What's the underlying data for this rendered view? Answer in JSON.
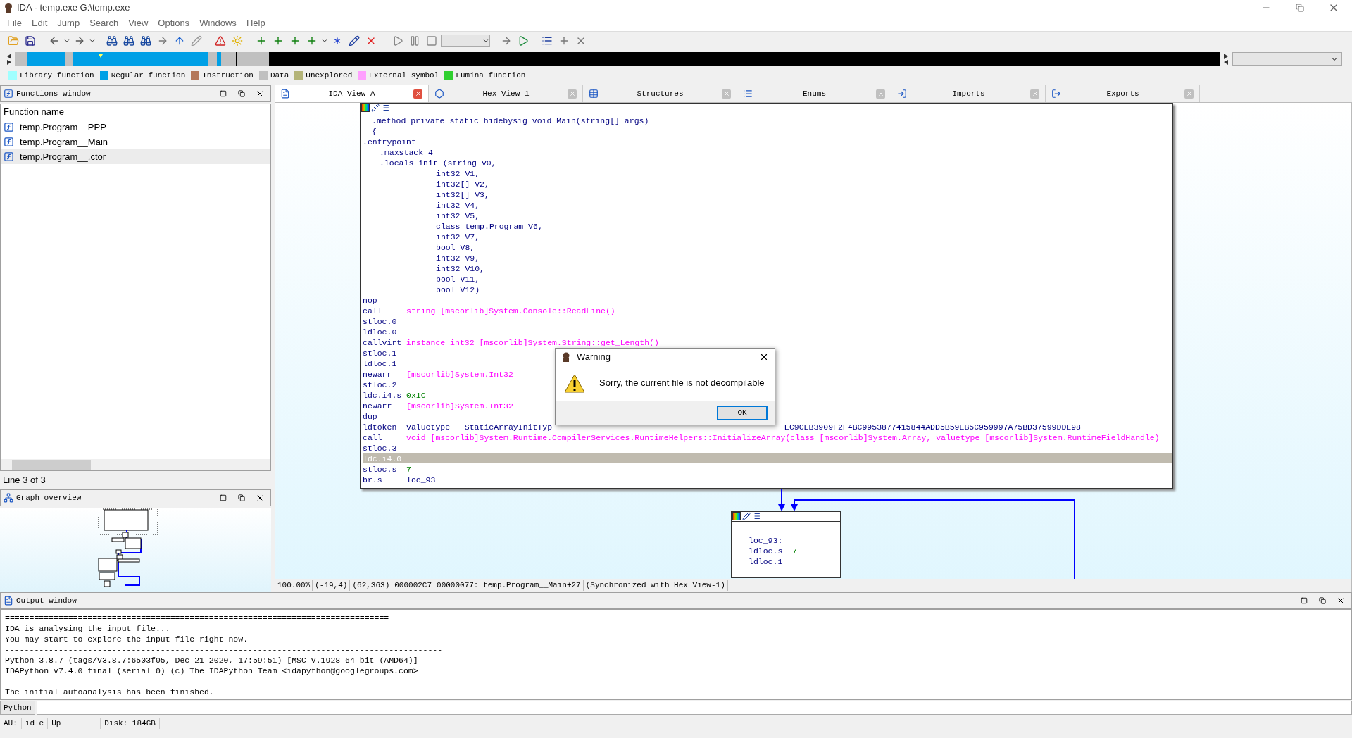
{
  "window": {
    "title": "IDA - temp.exe G:\\temp.exe"
  },
  "menu": [
    "File",
    "Edit",
    "Jump",
    "Search",
    "View",
    "Options",
    "Windows",
    "Help"
  ],
  "legend": [
    {
      "label": "Library function",
      "color": "#a0ffff"
    },
    {
      "label": "Regular function",
      "color": "#00a0e6"
    },
    {
      "label": "Instruction",
      "color": "#b4785a"
    },
    {
      "label": "Data",
      "color": "#c0c0c0"
    },
    {
      "label": "Unexplored",
      "color": "#b4b478"
    },
    {
      "label": "External symbol",
      "color": "#ffa0ff"
    },
    {
      "label": "Lumina function",
      "color": "#30d030"
    }
  ],
  "functions_window": {
    "title": "Functions window",
    "column": "Function name",
    "items": [
      {
        "name": "temp.Program__PPP",
        "selected": false
      },
      {
        "name": "temp.Program__Main",
        "selected": false
      },
      {
        "name": "temp.Program__.ctor",
        "selected": true
      }
    ],
    "status": "Line 3 of 3"
  },
  "graph_overview": {
    "title": "Graph overview"
  },
  "tabs": [
    {
      "label": "IDA View-A",
      "selected": true
    },
    {
      "label": "Hex View-1",
      "selected": false
    },
    {
      "label": "Structures",
      "selected": false
    },
    {
      "label": "Enums",
      "selected": false
    },
    {
      "label": "Imports",
      "selected": false
    },
    {
      "label": "Exports",
      "selected": false
    }
  ],
  "code": [
    {
      "kind": "decl",
      "text": ".method private static hidebysig void Main(string[] args)",
      "selected": false
    },
    {
      "kind": "decl",
      "text": "{",
      "selected": false
    },
    {
      "kind": "directive",
      "text": ".entrypoint",
      "selected": false
    },
    {
      "kind": "param",
      "text": ".maxstack 4",
      "selected": false
    },
    {
      "kind": "param",
      "text": ".locals init (string V0,",
      "selected": false
    },
    {
      "kind": "local",
      "text": "int32 V1,",
      "selected": false
    },
    {
      "kind": "local",
      "text": "int32[] V2,",
      "selected": false
    },
    {
      "kind": "local",
      "text": "int32[] V3,",
      "selected": false
    },
    {
      "kind": "local",
      "text": "int32 V4,",
      "selected": false
    },
    {
      "kind": "local",
      "text": "int32 V5,",
      "selected": false
    },
    {
      "kind": "local",
      "text": "class temp.Program V6,",
      "selected": false
    },
    {
      "kind": "local",
      "text": "int32 V7,",
      "selected": false
    },
    {
      "kind": "local",
      "text": "bool V8,",
      "selected": false
    },
    {
      "kind": "local",
      "text": "int32 V9,",
      "selected": false
    },
    {
      "kind": "local",
      "text": "int32 V10,",
      "selected": false
    },
    {
      "kind": "local",
      "text": "bool V11,",
      "selected": false
    },
    {
      "kind": "local",
      "text": "bool V12)",
      "selected": false
    },
    {
      "kind": "instr",
      "op": "nop",
      "selected": false
    },
    {
      "kind": "instr",
      "op": "call",
      "arg": {
        "text": "string [mscorlib]System.Console::ReadLine()",
        "kind": "ref"
      },
      "selected": false
    },
    {
      "kind": "instr",
      "op": "stloc.0",
      "selected": false
    },
    {
      "kind": "instr",
      "op": "ldloc.0",
      "selected": false
    },
    {
      "kind": "instr",
      "op": "callvirt",
      "arg": {
        "text": "instance int32 [mscorlib]System.String::get_Length()",
        "kind": "ref"
      },
      "selected": false
    },
    {
      "kind": "instr",
      "op": "stloc.1",
      "selected": false
    },
    {
      "kind": "instr",
      "op": "ldloc.1",
      "selected": false
    },
    {
      "kind": "instr",
      "op": "newarr",
      "arg": {
        "text": "[mscorlib]System.Int32",
        "kind": "ref"
      },
      "selected": false
    },
    {
      "kind": "instr",
      "op": "stloc.2",
      "selected": false
    },
    {
      "kind": "instr",
      "op": "ldc.i4.s",
      "arg": {
        "text": "0x1C",
        "kind": "num"
      },
      "selected": false
    },
    {
      "kind": "instr",
      "op": "newarr",
      "arg": {
        "text": "[mscorlib]System.Int32",
        "kind": "ref"
      },
      "selected": false
    },
    {
      "kind": "instr",
      "op": "dup",
      "selected": false
    },
    {
      "kind": "instr",
      "op": "ldtoken",
      "arg": {
        "text": "valuetype __StaticArrayInitTyp",
        "kind": "label"
      },
      "arg_tail": "EC9CEB3909F2F4BC9953877415844ADD5B59EB5C959997A75BD37599DDE98",
      "selected": false
    },
    {
      "kind": "instr",
      "op": "call",
      "arg": {
        "text": "void [mscorlib]System.Runtime.CompilerServices.RuntimeHelpers::InitializeArray(class [mscorlib]System.Array, valuetype [mscorlib]System.RuntimeFieldHandle)",
        "kind": "ref"
      },
      "selected": false
    },
    {
      "kind": "instr",
      "op": "stloc.3",
      "selected": false
    },
    {
      "kind": "instr",
      "op": "ldc.i4.0",
      "selected": true
    },
    {
      "kind": "instr",
      "op": "stloc.s",
      "arg": {
        "text": "7",
        "kind": "num"
      },
      "selected": false
    },
    {
      "kind": "instr",
      "op": "br.s",
      "arg": {
        "text": "loc_93",
        "kind": "label"
      },
      "selected": false
    }
  ],
  "node2": [
    {
      "kind": "label",
      "op": "loc_93:"
    },
    {
      "kind": "instr",
      "op": "ldloc.s",
      "arg": {
        "text": "7",
        "kind": "num"
      }
    },
    {
      "kind": "instr",
      "op": "ldloc.1"
    }
  ],
  "dialog": {
    "title": "Warning",
    "message": "Sorry, the current file is not decompilable",
    "button": "OK"
  },
  "view_status": [
    "100.00%",
    "(-19,4)",
    "(62,363)",
    "000002C7",
    "00000077: temp.Program__Main+27",
    "(Synchronized with Hex View-1)"
  ],
  "output_window": {
    "title": "Output window",
    "lines": [
      "===============================================================================",
      "IDA is analysing the input file...",
      "You may start to explore the input file right now.",
      "------------------------------------------------------------------------------------------",
      "Python 3.8.7 (tags/v3.8.7:6503f05, Dec 21 2020, 17:59:51) [MSC v.1928 64 bit (AMD64)]",
      "IDAPython v7.4.0 final (serial 0) (c) The IDAPython Team <idapython@googlegroups.com>",
      "------------------------------------------------------------------------------------------",
      "The initial autoanalysis has been finished."
    ],
    "input_label": "Python"
  },
  "status_bar": [
    "AU:",
    "idle",
    "Up",
    "Disk: 184GB"
  ]
}
